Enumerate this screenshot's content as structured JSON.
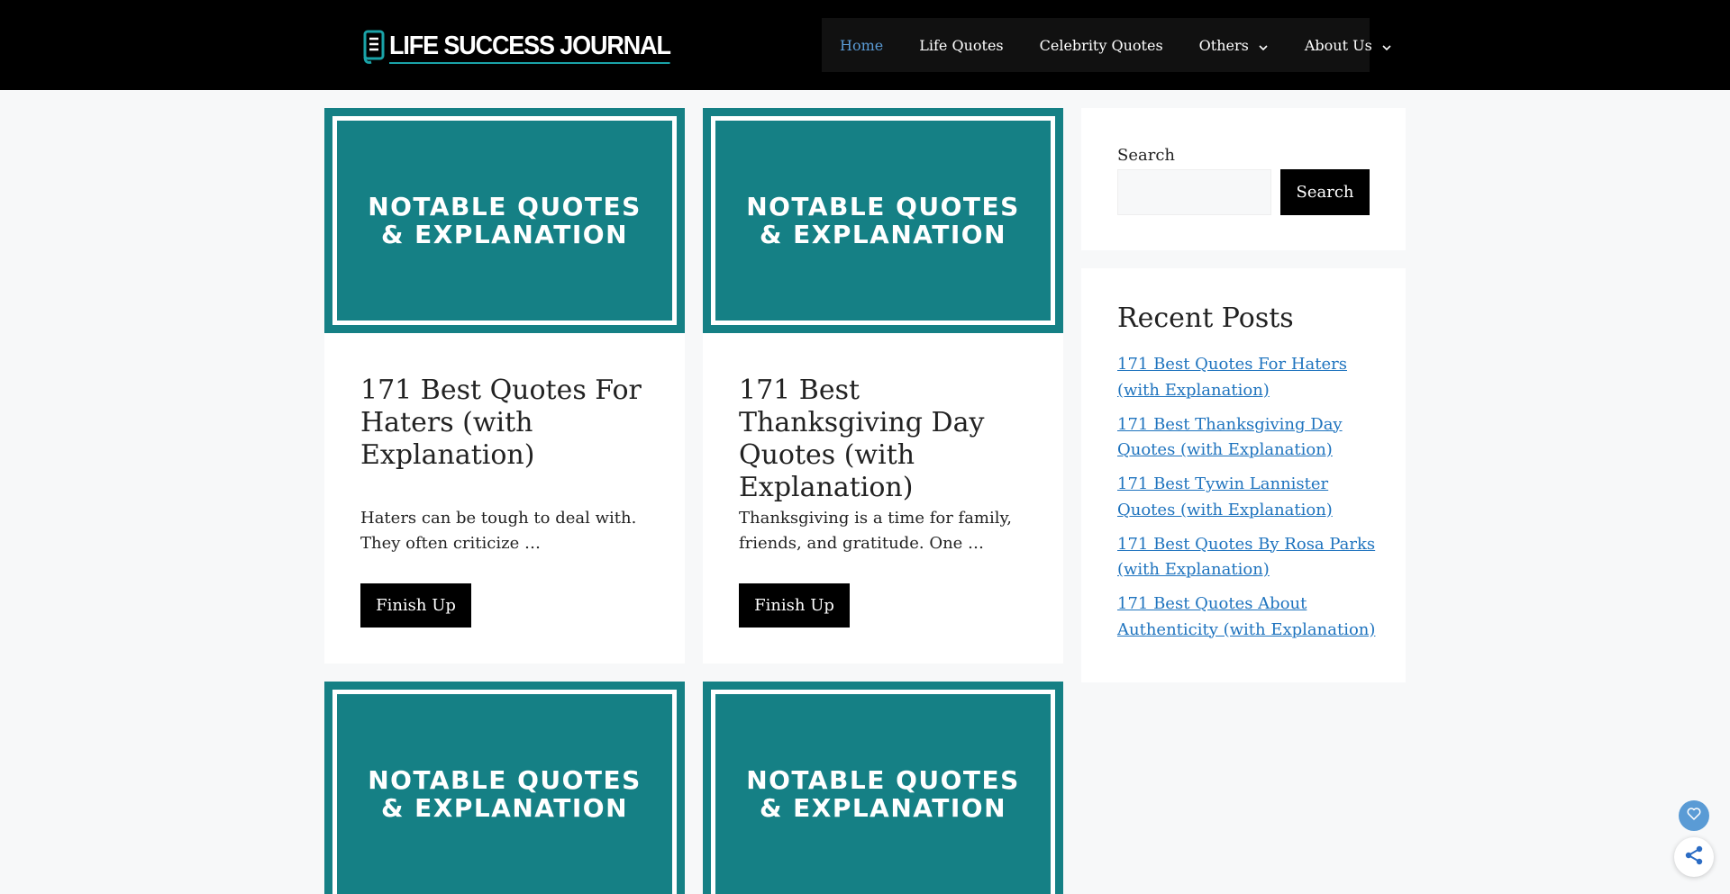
{
  "header": {
    "logo_text": "LIFE SUCCESS JOURNAL",
    "nav": [
      {
        "label": "Home",
        "active": true
      },
      {
        "label": "Life Quotes"
      },
      {
        "label": "Celebrity Quotes"
      },
      {
        "label": "Others",
        "has_dropdown": true
      },
      {
        "label": "About Us",
        "has_dropdown": true
      }
    ]
  },
  "posts": [
    {
      "thumb_line1": "NOTABLE QUOTES",
      "thumb_line2": "& EXPLANATION",
      "title": "171 Best Quotes For Haters (with Explanation)",
      "excerpt": "Haters can be tough to deal with. They often criticize …",
      "button": "Finish Up"
    },
    {
      "thumb_line1": "NOTABLE QUOTES",
      "thumb_line2": "& EXPLANATION",
      "title": "171 Best Thanksgiving Day Quotes (with Explanation)",
      "excerpt": "Thanksgiving is a time for family, friends, and gratitude. One …",
      "button": "Finish Up"
    },
    {
      "thumb_line1": "NOTABLE QUOTES",
      "thumb_line2": "& EXPLANATION"
    },
    {
      "thumb_line1": "NOTABLE QUOTES",
      "thumb_line2": "& EXPLANATION"
    }
  ],
  "sidebar": {
    "search_label": "Search",
    "search_button": "Search",
    "search_value": "",
    "recent_title": "Recent Posts",
    "recent_posts": [
      "171 Best Quotes For Haters (with Explanation)",
      "171 Best Thanksgiving Day Quotes (with Explanation)",
      "171 Best Tywin Lannister Quotes (with Explanation)",
      "171 Best Quotes By Rosa Parks (with Explanation)",
      "171 Best Quotes About Authenticity (with Explanation)"
    ]
  },
  "colors": {
    "header_bg": "#000000",
    "accent": "#158085",
    "link": "#1e73be",
    "nav_active": "#5a9bd5"
  },
  "icons": {
    "logo": "document-lines-icon",
    "dropdown": "chevron-down-icon",
    "heart": "heart-icon",
    "share": "share-icon"
  }
}
